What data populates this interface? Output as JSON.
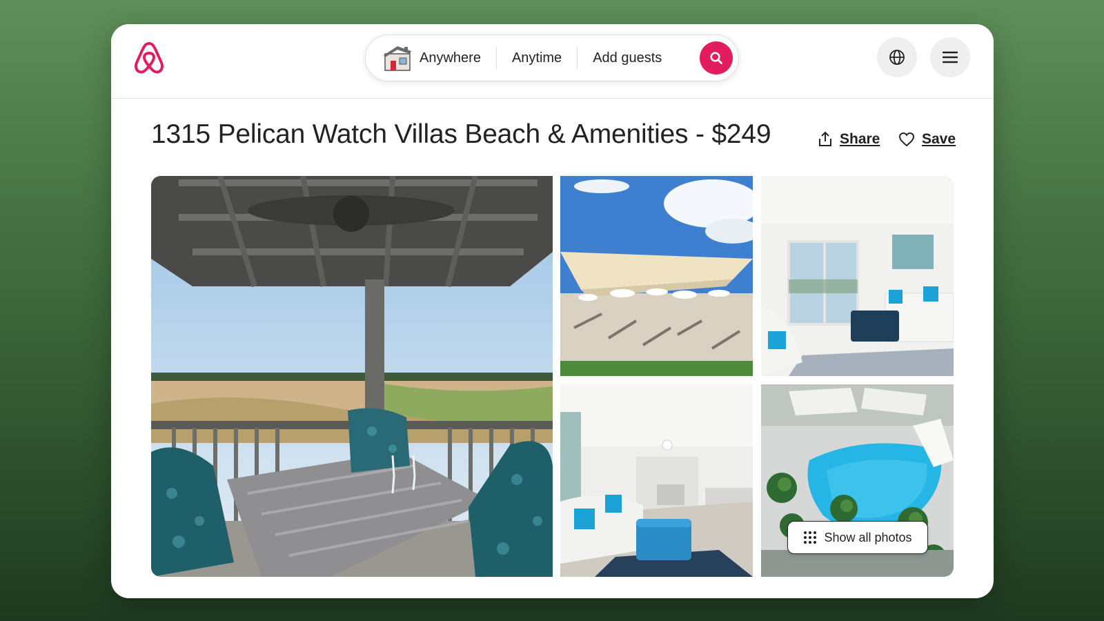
{
  "header": {
    "logo_icon": "airbnb-logo-icon",
    "brand_color": "#e31c5f",
    "search": {
      "where": "Anywhere",
      "when": "Anytime",
      "guests": "Add guests"
    },
    "icons": [
      "house-icon",
      "search-icon",
      "globe-icon",
      "hamburger-menu-icon"
    ]
  },
  "listing": {
    "title": "1315 Pelican Watch Villas Beach & Amenities - $249",
    "share_label": "Share",
    "save_label": "Save"
  },
  "gallery": {
    "show_all_label": "Show all photos"
  }
}
